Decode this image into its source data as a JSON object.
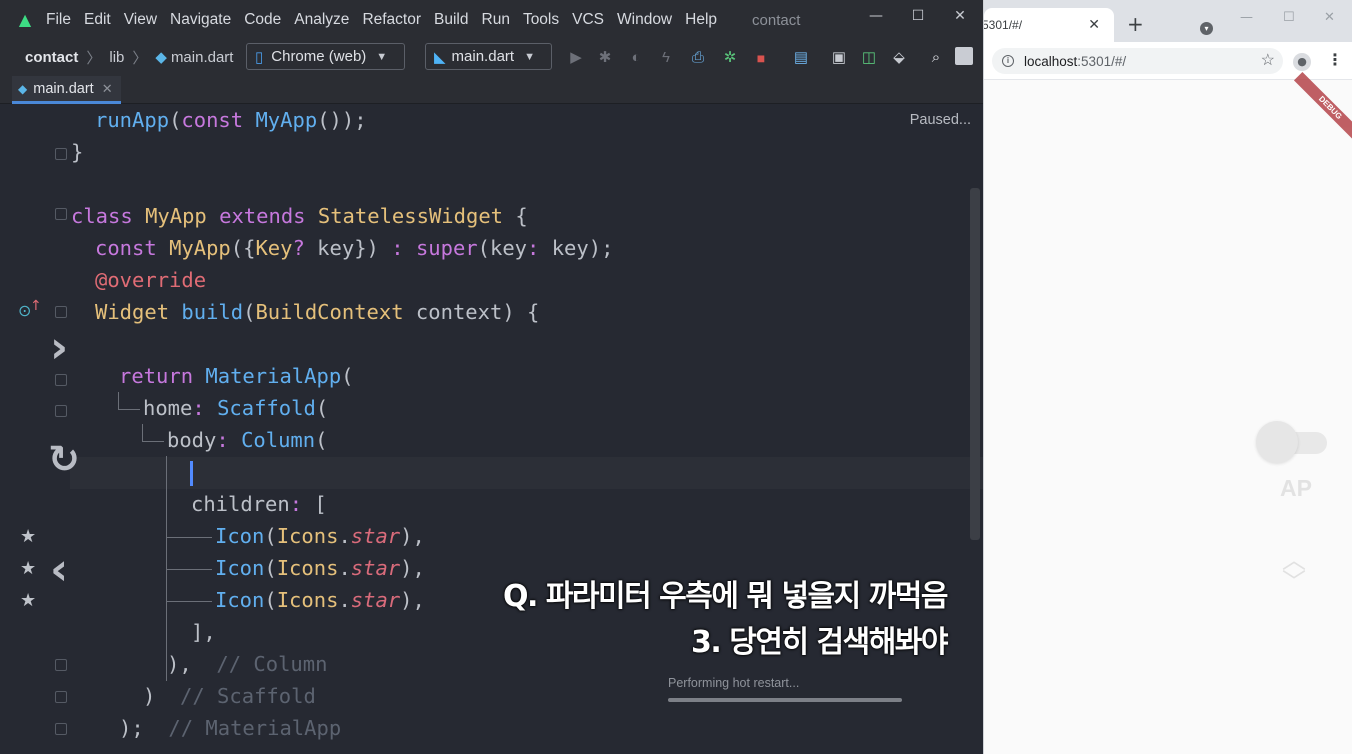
{
  "ide": {
    "menu": [
      "File",
      "Edit",
      "View",
      "Navigate",
      "Code",
      "Analyze",
      "Refactor",
      "Build",
      "Run",
      "Tools",
      "VCS",
      "Window",
      "Help"
    ],
    "project_title": "contact",
    "breadcrumb": [
      "contact",
      "lib",
      "main.dart"
    ],
    "device_selector": "Chrome (web)",
    "run_config": "main.dart",
    "tab": {
      "label": "main.dart"
    },
    "status": "Paused...",
    "colors": {
      "keyword": "#c678dd",
      "function": "#61afef",
      "class": "#e5c07b",
      "annotation": "#e06c75",
      "comment": "#5c6370",
      "accent": "#4a88d8"
    }
  },
  "caption": {
    "line1": "Q. 파라미터 우측에 뭐 넣을지 까먹음",
    "line2": "3. 당연히 검색해봐야"
  },
  "progress": {
    "label": "Performing hot restart...",
    "value": 1.0
  },
  "browser": {
    "tab_title": "5301/#/",
    "url_host": "localhost",
    "url_path": ":5301/#/",
    "debug_label": "DEBUG",
    "app_label": "AP"
  }
}
